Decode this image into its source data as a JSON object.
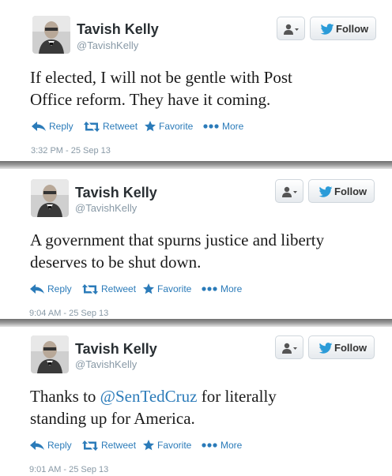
{
  "colors": {
    "link": "#2b7bb9",
    "muted": "#8899a6",
    "text": "#1a1a1a"
  },
  "tweets": [
    {
      "name": "Tavish Kelly",
      "handle": "@TavishKelly",
      "text_parts": [
        "If elected, I will not be gentle with Post",
        "Office reform.  They have it coming."
      ],
      "actions": {
        "reply": "Reply",
        "retweet": "Retweet",
        "favorite": "Favorite",
        "more": "More"
      },
      "follow_label": "Follow",
      "timestamp": "3:32 PM - 25 Sep 13"
    },
    {
      "name": "Tavish Kelly",
      "handle": "@TavishKelly",
      "text_parts": [
        "A government that spurns justice and liberty",
        "deserves to be shut down."
      ],
      "actions": {
        "reply": "Reply",
        "retweet": "Retweet",
        "favorite": "Favorite",
        "more": "More"
      },
      "follow_label": "Follow",
      "timestamp": "9:04 AM - 25 Sep 13"
    },
    {
      "name": "Tavish Kelly",
      "handle": "@TavishKelly",
      "text_pre": "Thanks to ",
      "mention": "@SenTedCruz",
      "text_post": " for literally",
      "text_line2": "standing up for America.",
      "actions": {
        "reply": "Reply",
        "retweet": "Retweet",
        "favorite": "Favorite",
        "more": "More"
      },
      "follow_label": "Follow",
      "timestamp": "9:01 AM - 25 Sep 13"
    }
  ]
}
